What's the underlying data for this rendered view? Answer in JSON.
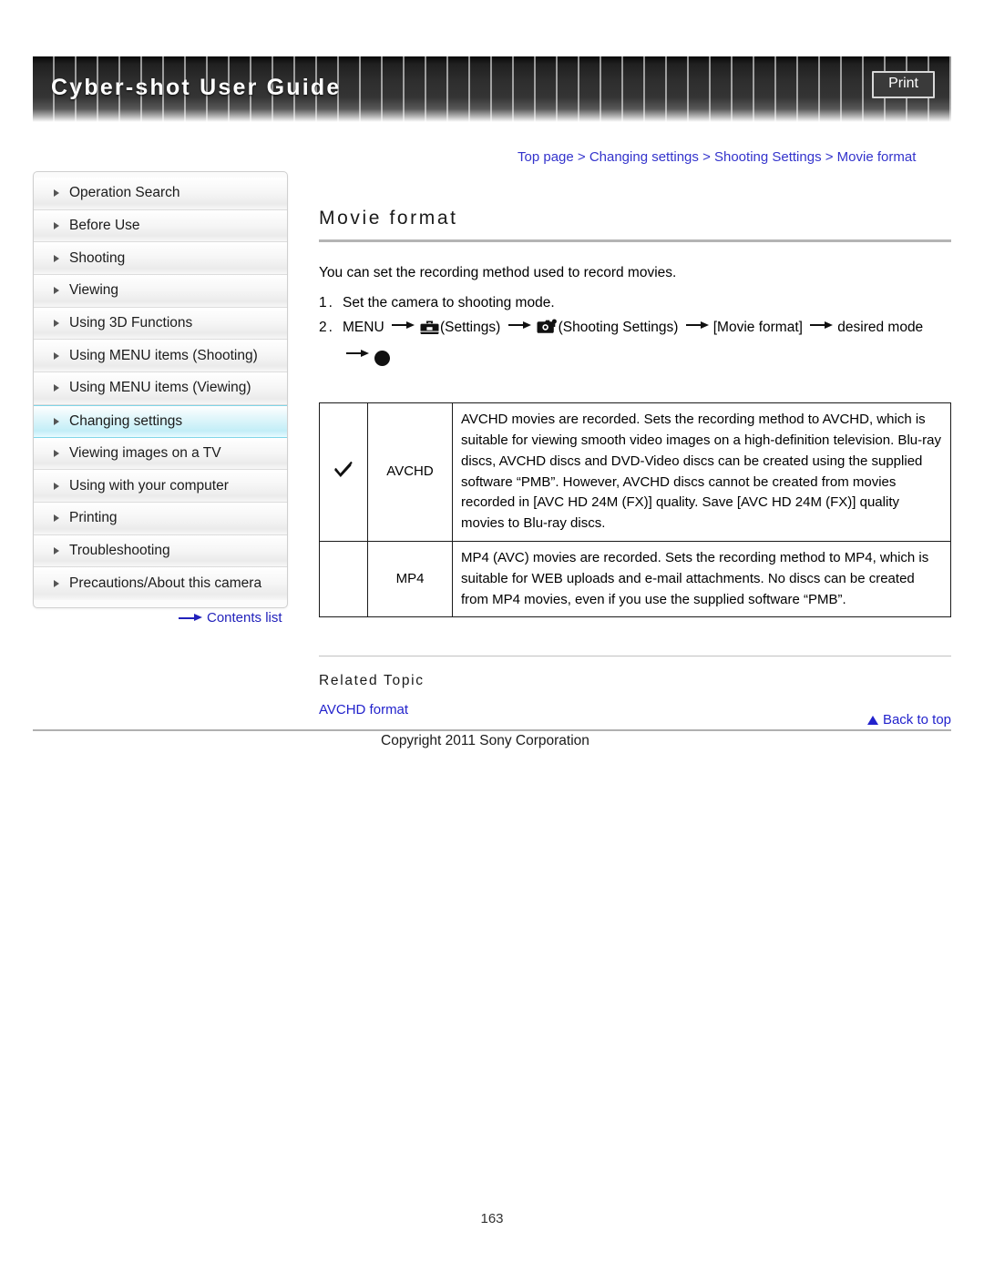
{
  "header": {
    "title": "Cyber-shot User Guide",
    "print_label": "Print"
  },
  "sidebar": {
    "items": [
      {
        "label": "Operation Search",
        "active": false
      },
      {
        "label": "Before Use",
        "active": false
      },
      {
        "label": "Shooting",
        "active": false
      },
      {
        "label": "Viewing",
        "active": false
      },
      {
        "label": "Using 3D Functions",
        "active": false
      },
      {
        "label": "Using MENU items (Shooting)",
        "active": false
      },
      {
        "label": "Using MENU items (Viewing)",
        "active": false
      },
      {
        "label": "Changing settings",
        "active": true
      },
      {
        "label": "Viewing images on a TV",
        "active": false
      },
      {
        "label": "Using with your computer",
        "active": false
      },
      {
        "label": "Printing",
        "active": false
      },
      {
        "label": "Troubleshooting",
        "active": false
      },
      {
        "label": "Precautions/About this camera",
        "active": false
      }
    ],
    "contents_list_label": "Contents list"
  },
  "breadcrumb": {
    "text": "Top page > Changing settings > Shooting Settings > Movie format"
  },
  "main": {
    "title": "Movie format",
    "intro": "You can set the recording method used to record movies.",
    "steps": [
      {
        "number": "1.",
        "parts": [
          {
            "type": "text",
            "value": "Set the camera to shooting mode."
          }
        ]
      },
      {
        "number": "2.",
        "parts": [
          {
            "type": "text",
            "value": "MENU"
          },
          {
            "type": "arrow"
          },
          {
            "type": "icon",
            "value": "toolbox-icon"
          },
          {
            "type": "text",
            "value": "(Settings)"
          },
          {
            "type": "arrow"
          },
          {
            "type": "icon",
            "value": "camera-settings-icon"
          },
          {
            "type": "text",
            "value": "(Shooting Settings)"
          },
          {
            "type": "arrow"
          },
          {
            "type": "text",
            "value": "[Movie format]"
          },
          {
            "type": "arrow"
          },
          {
            "type": "text",
            "value": "desired mode"
          },
          {
            "type": "arrow"
          },
          {
            "type": "icon",
            "value": "filled-circle-icon"
          }
        ]
      }
    ],
    "table": {
      "rows": [
        {
          "checked": true,
          "check_glyph": "check-icon",
          "label": "AVCHD",
          "description": "AVCHD movies are recorded. Sets the recording method to AVCHD, which is suitable for viewing smooth video images on a high-definition television. Blu-ray discs, AVCHD discs and DVD-Video discs can be created using the supplied software “PMB”. However, AVCHD discs cannot be created from movies recorded in [AVC HD 24M (FX)] quality. Save [AVC HD 24M (FX)] quality movies to Blu-ray discs."
        },
        {
          "checked": false,
          "check_glyph": "",
          "label": "MP4",
          "description": "MP4 (AVC) movies are recorded. Sets the recording method to MP4, which is suitable for WEB uploads and e-mail attachments. No discs can be created from MP4 movies, even if you use the supplied software “PMB”."
        }
      ]
    },
    "related": {
      "heading": "Related Topic",
      "links": [
        "AVCHD format"
      ]
    }
  },
  "footer": {
    "back_to_top": "Back to top",
    "copyright": "Copyright 2011 Sony Corporation",
    "page_number": "163"
  },
  "colors": {
    "link": "#2222cc",
    "breadcrumb": "#3333cc",
    "active_nav": "#c3eef7",
    "banner_dark": "#2e2e2e"
  }
}
